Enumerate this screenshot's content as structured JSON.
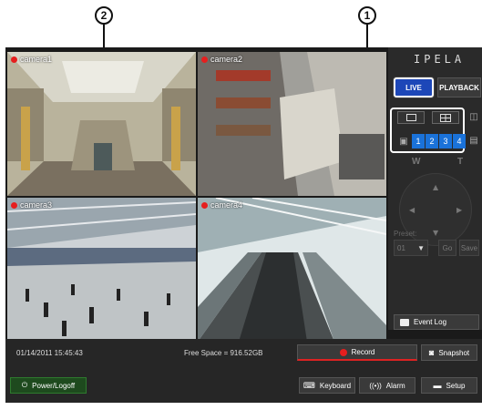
{
  "callouts": {
    "one": "1",
    "two": "2"
  },
  "cameras": [
    {
      "label": "camera1"
    },
    {
      "label": "camera2"
    },
    {
      "label": "camera3"
    },
    {
      "label": "camera4"
    }
  ],
  "panel": {
    "brand": "IPELA",
    "live_label": "LIVE",
    "playback_label": "PLAYBACK",
    "channels": [
      "1",
      "2",
      "3",
      "4"
    ],
    "zoom_wide": "W",
    "zoom_tele": "T",
    "preset_label": "Preset:",
    "preset_value": "01",
    "go_label": "Go",
    "save_label": "Save",
    "event_log_label": "Event Log"
  },
  "status": {
    "datetime": "01/14/2011 15:45:43",
    "free_space": "Free Space  = 916.52GB",
    "record_label": "Record",
    "snapshot_label": "Snapshot",
    "power_label": "Power/Logoff",
    "keyboard_label": "Keyboard",
    "alarm_label": "Alarm",
    "setup_label": "Setup"
  },
  "colors": {
    "accent": "#1d47b8",
    "channel": "#1a72d9",
    "record": "#e61e1e",
    "panel": "#2a2a2a"
  }
}
